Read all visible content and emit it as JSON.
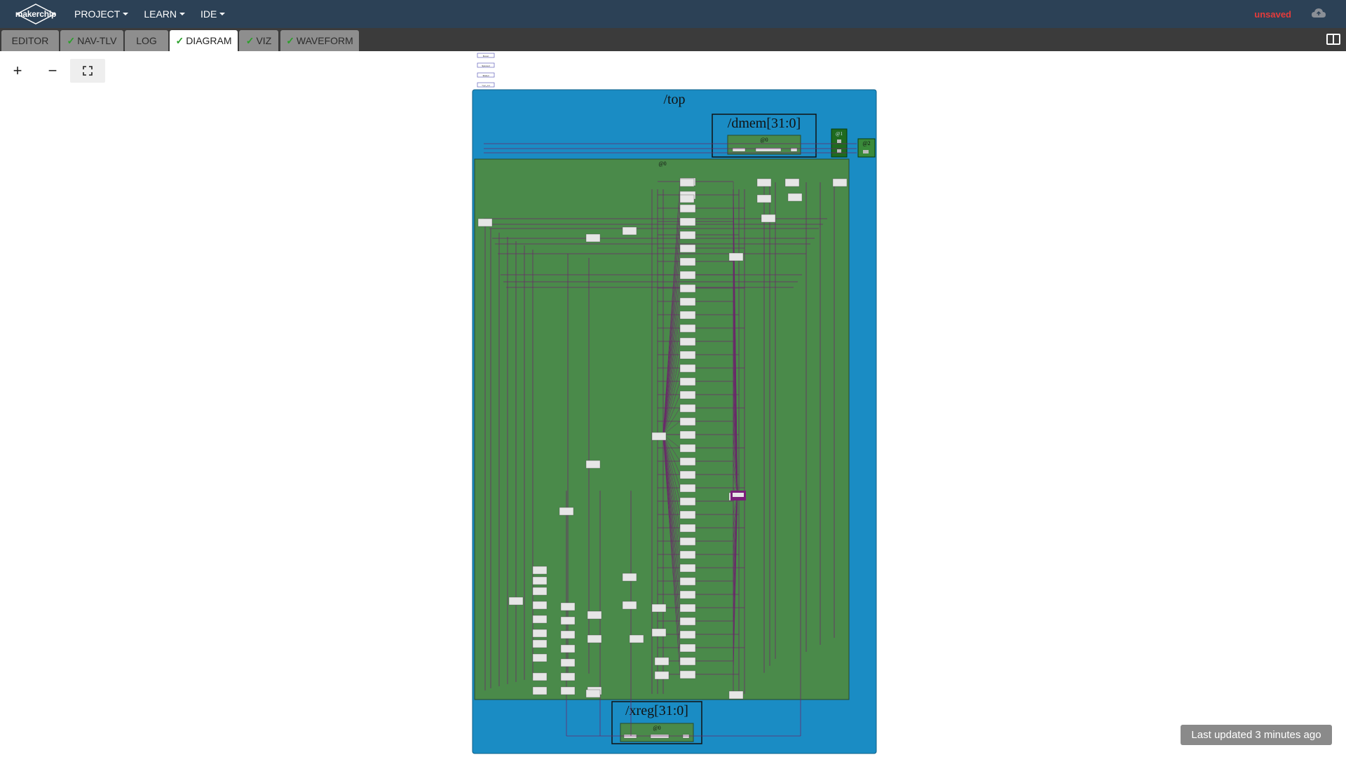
{
  "app": {
    "logo_text": "makerchip",
    "menu": [
      {
        "label": "PROJECT"
      },
      {
        "label": "LEARN"
      },
      {
        "label": "IDE"
      }
    ],
    "status": "unsaved"
  },
  "tabs": [
    {
      "label": "EDITOR",
      "checked": false,
      "active": false
    },
    {
      "label": "NAV-TLV",
      "checked": true,
      "active": false
    },
    {
      "label": "LOG",
      "checked": false,
      "active": false
    },
    {
      "label": "DIAGRAM",
      "checked": true,
      "active": true
    },
    {
      "label": "VIZ",
      "checked": true,
      "active": false
    },
    {
      "label": "WAVEFORM",
      "checked": true,
      "active": false
    }
  ],
  "zoom": {
    "in": "+",
    "out": "−"
  },
  "diagram": {
    "top_label": "/top",
    "dmem_label": "/dmem[31:0]",
    "dmem_stage": "@0",
    "main_stage": "@0",
    "xreg_label": "/xreg[31:0]",
    "xreg_stage": "@0",
    "side_stage_1": "@1",
    "side_stage_2": "@2",
    "legend": [
      "$reset",
      "$passed",
      "$failed",
      "*cyc_cnt"
    ]
  },
  "footer": {
    "last_updated": "Last updated 3 minutes ago"
  },
  "colors": {
    "navbar": "#2c4156",
    "top_scope": "#1a8cc4",
    "pipe_green": "#4a8a4a",
    "wire": "#6a2a6a",
    "unsaved": "#e63b3b"
  }
}
